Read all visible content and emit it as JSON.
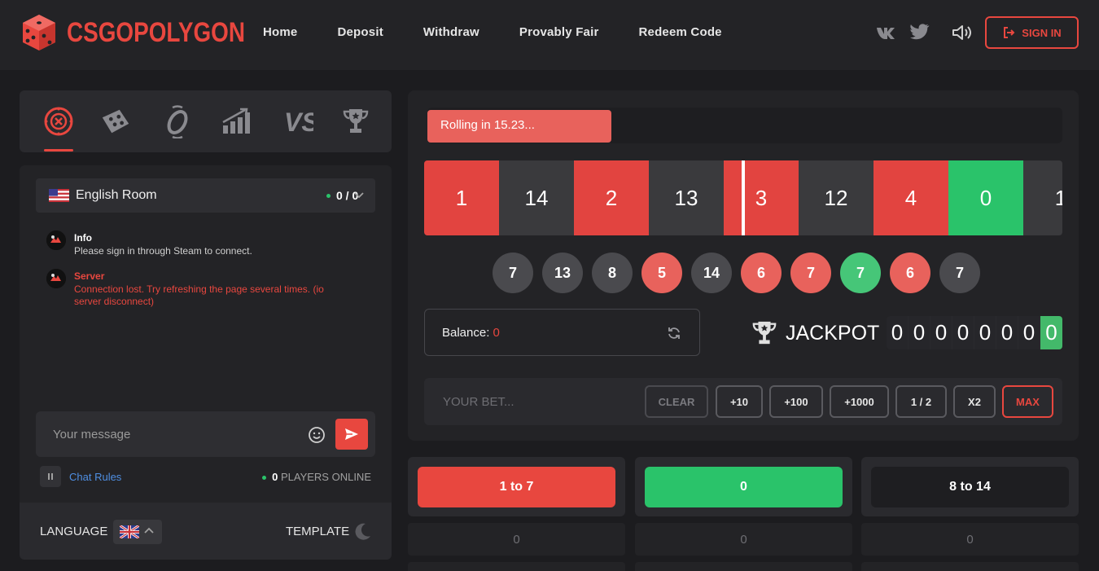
{
  "brand": {
    "name": "CSGOPOLYGON",
    "accent": "#e8473f",
    "green": "#2ac36a"
  },
  "nav": [
    "Home",
    "Deposit",
    "Withdraw",
    "Provably Fair",
    "Redeem Code"
  ],
  "header": {
    "signin_label": "SIGN IN",
    "icons": [
      "vk-icon",
      "twitter-icon",
      "sound-icon"
    ]
  },
  "game_tabs": [
    "roulette-icon",
    "dice-icon",
    "coinflip-icon",
    "crash-icon",
    "versus-icon",
    "trophy-icon"
  ],
  "chat": {
    "room_name": "English Room",
    "room_count": "0 / 0",
    "messages": [
      {
        "title": "Info",
        "body": "Please sign in through Steam to connect.",
        "color": "#ffffff"
      },
      {
        "title": "Server",
        "body": "Connection lost. Try refreshing the page several times. (io server disconnect)",
        "color": "#e8473f"
      }
    ],
    "input_placeholder": "Your message",
    "rules_label": "Chat Rules",
    "players_count": "0",
    "players_label": "PLAYERS ONLINE"
  },
  "settings": {
    "language_label": "LANGUAGE",
    "template_label": "TEMPLATE"
  },
  "roulette": {
    "rolling_text": "Rolling in 15.23...",
    "progress_fraction": 0.32,
    "wheel": [
      {
        "n": "1",
        "c": "red"
      },
      {
        "n": "14",
        "c": "dark"
      },
      {
        "n": "2",
        "c": "red"
      },
      {
        "n": "13",
        "c": "dark"
      },
      {
        "n": "3",
        "c": "red"
      },
      {
        "n": "12",
        "c": "dark"
      },
      {
        "n": "4",
        "c": "red"
      },
      {
        "n": "0",
        "c": "green"
      },
      {
        "n": "1",
        "c": "dark"
      }
    ],
    "history": [
      {
        "n": "7",
        "c": "gray"
      },
      {
        "n": "13",
        "c": "gray"
      },
      {
        "n": "8",
        "c": "gray"
      },
      {
        "n": "5",
        "c": "red"
      },
      {
        "n": "14",
        "c": "gray"
      },
      {
        "n": "6",
        "c": "red"
      },
      {
        "n": "7",
        "c": "red"
      },
      {
        "n": "7",
        "c": "green"
      },
      {
        "n": "6",
        "c": "red"
      },
      {
        "n": "7",
        "c": "gray"
      }
    ],
    "balance_label": "Balance:",
    "balance_value": "0",
    "jackpot_label": "JACKPOT",
    "jackpot_digits": [
      "0",
      "0",
      "0",
      "0",
      "0",
      "0",
      "0",
      "0"
    ],
    "bet_placeholder": "YOUR BET...",
    "bet_buttons": [
      "CLEAR",
      "+10",
      "+100",
      "+1000",
      "1 / 2",
      "X2",
      "MAX"
    ]
  },
  "bets": [
    {
      "label": "1 to 7",
      "total": "0",
      "color": "#e8473f"
    },
    {
      "label": "0",
      "total": "0",
      "color": "#2ac36a"
    },
    {
      "label": "8 to 14",
      "total": "0",
      "color": "#1e1e21"
    }
  ]
}
